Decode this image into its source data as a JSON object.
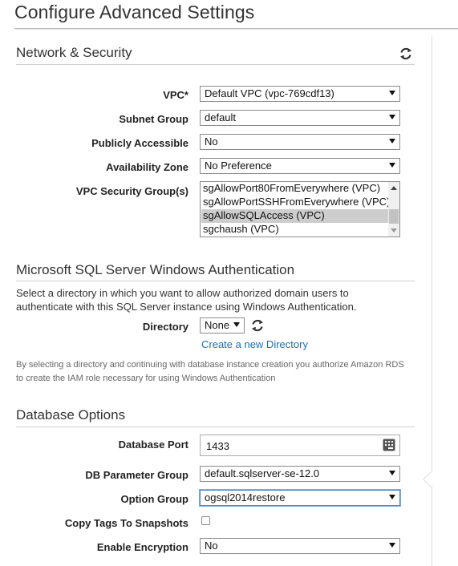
{
  "page": {
    "title": "Configure Advanced Settings"
  },
  "network_security": {
    "title": "Network & Security",
    "refresh_icon": "refresh-icon",
    "vpc": {
      "label": "VPC*",
      "value": "Default VPC (vpc-769cdf13)"
    },
    "subnet_group": {
      "label": "Subnet Group",
      "value": "default"
    },
    "publicly_accessible": {
      "label": "Publicly Accessible",
      "value": "No"
    },
    "availability_zone": {
      "label": "Availability Zone",
      "value": "No Preference"
    },
    "security_groups": {
      "label": "VPC Security Group(s)",
      "options": [
        {
          "text": "sgAllowPort80FromEverywhere (VPC)",
          "selected": false
        },
        {
          "text": "sgAllowPortSSHFromEverywhere (VPC)",
          "selected": false
        },
        {
          "text": "sgAllowSQLAccess (VPC)",
          "selected": true
        },
        {
          "text": "sgchaush (VPC)",
          "selected": false
        }
      ]
    }
  },
  "windows_auth": {
    "title": "Microsoft SQL Server Windows Authentication",
    "description": "Select a directory in which you want to allow authorized domain users to authenticate with this SQL Server instance using Windows Authentication.",
    "directory": {
      "label": "Directory",
      "value": "None"
    },
    "create_link": "Create a new Directory",
    "note": "By selecting a directory and continuing with database instance creation you authorize Amazon RDS to create the IAM role necessary for using Windows Authentication"
  },
  "database_options": {
    "title": "Database Options",
    "port": {
      "label": "Database Port",
      "value": "1433",
      "icon": "keypad-icon"
    },
    "parameter_group": {
      "label": "DB Parameter Group",
      "value": "default.sqlserver-se-12.0"
    },
    "option_group": {
      "label": "Option Group",
      "value": "ogsql2014restore"
    },
    "copy_tags": {
      "label": "Copy Tags To Snapshots",
      "checked": false
    },
    "encryption": {
      "label": "Enable Encryption",
      "value": "No"
    }
  }
}
